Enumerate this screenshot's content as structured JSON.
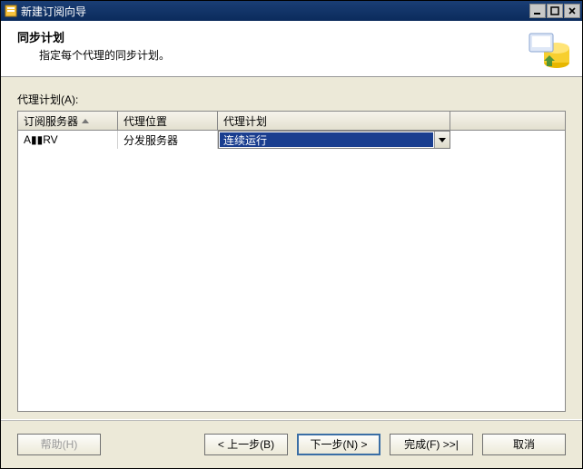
{
  "window": {
    "title": "新建订阅向导"
  },
  "banner": {
    "title": "同步计划",
    "subtitle": "指定每个代理的同步计划。"
  },
  "grid": {
    "label": "代理计划(A):",
    "columns": {
      "subscriber": "订阅服务器",
      "agent_location": "代理位置",
      "agent_schedule": "代理计划"
    },
    "rows": [
      {
        "subscriber": "A▮▮RV",
        "agent_location": "分发服务器",
        "agent_schedule_selected": "连续运行"
      }
    ]
  },
  "buttons": {
    "help": "帮助(H)",
    "back": "< 上一步(B)",
    "next": "下一步(N) >",
    "finish": "完成(F) >>|",
    "cancel": "取消"
  }
}
